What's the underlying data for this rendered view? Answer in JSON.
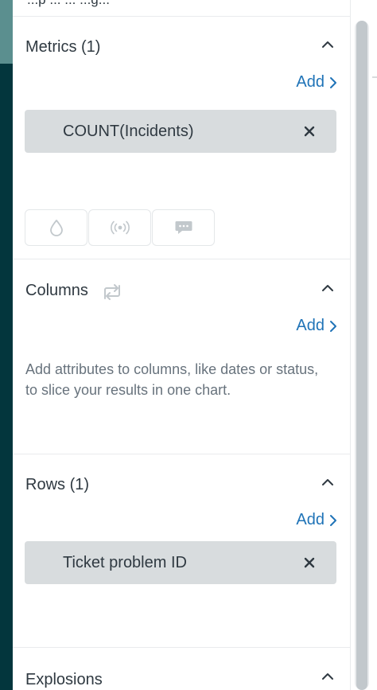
{
  "top_strip": {
    "clipped_text": "...p ... ... ...g..."
  },
  "metrics": {
    "title": "Metrics (1)",
    "add_label": "Add",
    "items": [
      {
        "label": "COUNT(Incidents)"
      }
    ]
  },
  "display_options": {
    "icons": [
      "drop-icon",
      "broadcast-icon",
      "speech-bubble-icon"
    ]
  },
  "columns": {
    "title": "Columns",
    "add_label": "Add",
    "help_text": "Add attributes to columns, like dates or status, to slice your results in one chart."
  },
  "rows": {
    "title": "Rows (1)",
    "add_label": "Add",
    "items": [
      {
        "label": "Ticket problem ID"
      }
    ]
  },
  "explosions": {
    "title": "Explosions"
  },
  "colors": {
    "rail": "#03363d",
    "link": "#1f73b7",
    "pill": "#d8dcde",
    "text": "#2f3941",
    "muted": "#68737d"
  }
}
